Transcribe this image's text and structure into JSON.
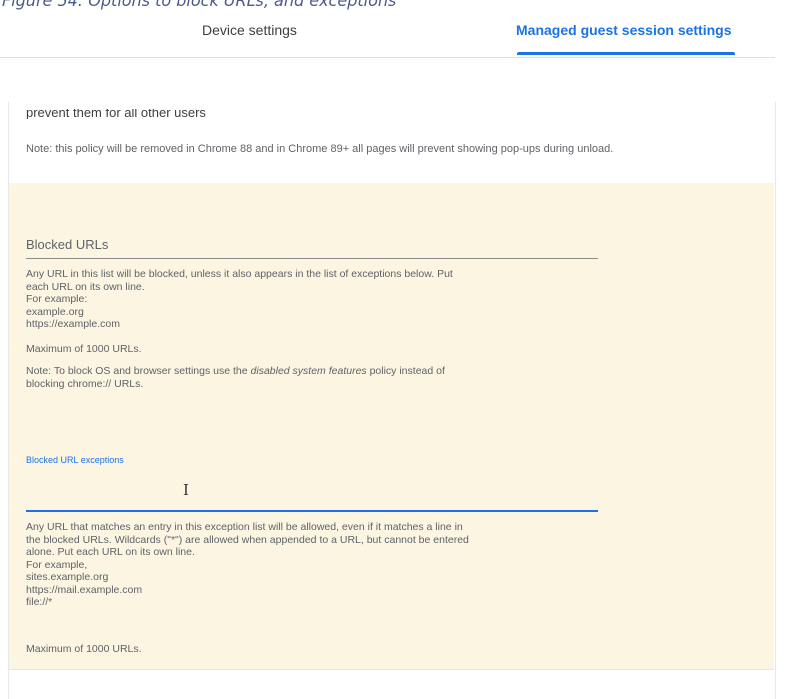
{
  "caption": "Figure 54: Options to block URLs, and exceptions",
  "tabs": [
    {
      "label": "Device settings",
      "active": false
    },
    {
      "label": "Managed guest session settings",
      "active": true
    }
  ],
  "prev_policy": {
    "cut_text": "prevent them for all other users",
    "note": "Note: this policy will be removed in Chrome 88 and in Chrome 89+ all pages will prevent showing pop-ups during unload."
  },
  "blocked_urls": {
    "title": "Blocked URLs",
    "help": [
      "Any URL in this list will be blocked, unless it also appears in the list of exceptions below. Put",
      "each URL on its own line.",
      "For example:",
      "example.org",
      "https://example.com"
    ],
    "maximum": "Maximum of 1000 URLs.",
    "note_prefix": "Note: To block OS and browser settings use the ",
    "note_emphasis": "disabled system features",
    "note_suffix": " policy instead of",
    "note_line2": "blocking chrome:// URLs."
  },
  "exceptions": {
    "label": "Blocked URL exceptions",
    "value": "",
    "help": [
      "Any URL that matches an entry in this exception list will be allowed, even if it matches a line in",
      "the blocked URLs. Wildcards (\"*\") are allowed when appended to a URL, but cannot be entered",
      "alone. Put each URL on its own line.",
      "For example,",
      "sites.example.org",
      "https://mail.example.com",
      "file://*"
    ],
    "maximum": "Maximum of 1000 URLs."
  },
  "colors": {
    "accent": "#1a73e8",
    "highlight_bg": "#fbf5e2"
  }
}
